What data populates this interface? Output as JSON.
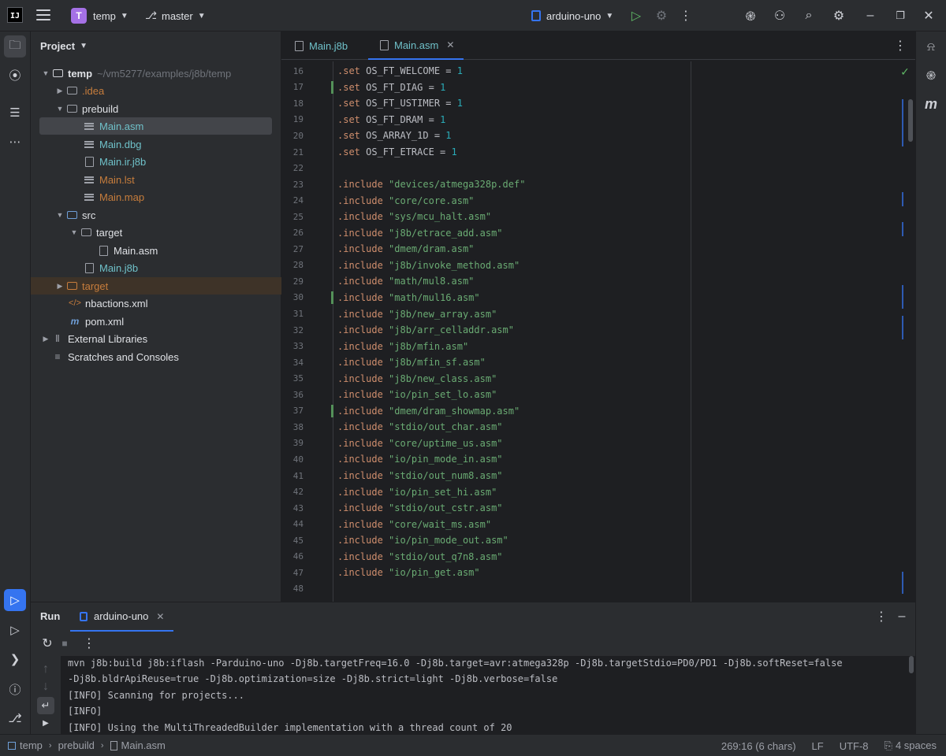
{
  "titlebar": {
    "project_badge": "T",
    "project_name": "temp",
    "branch": "master",
    "run_config": "arduino-uno"
  },
  "project_panel": {
    "title": "Project",
    "tree": [
      {
        "label": "temp",
        "path": "~/vm5277/examples/j8b/temp"
      },
      {
        "label": ".idea"
      },
      {
        "label": "prebuild"
      },
      {
        "label": "Main.asm"
      },
      {
        "label": "Main.dbg"
      },
      {
        "label": "Main.ir.j8b"
      },
      {
        "label": "Main.lst"
      },
      {
        "label": "Main.map"
      },
      {
        "label": "src"
      },
      {
        "label": "target"
      },
      {
        "label": "Main.asm"
      },
      {
        "label": "Main.j8b"
      },
      {
        "label": "target"
      },
      {
        "label": "nbactions.xml"
      },
      {
        "label": "pom.xml"
      },
      {
        "label": "External Libraries"
      },
      {
        "label": "Scratches and Consoles"
      }
    ]
  },
  "editor": {
    "tabs": [
      {
        "label": "Main.j8b"
      },
      {
        "label": "Main.asm"
      }
    ],
    "lines": [
      {
        "n": "16",
        "d": ".set",
        "t": " OS_FT_WELCOME = ",
        "v": "1"
      },
      {
        "n": "17",
        "d": ".set",
        "t": " OS_FT_DIAG = ",
        "v": "1"
      },
      {
        "n": "18",
        "d": ".set",
        "t": " OS_FT_USTIMER = ",
        "v": "1"
      },
      {
        "n": "19",
        "d": ".set",
        "t": " OS_FT_DRAM = ",
        "v": "1"
      },
      {
        "n": "20",
        "d": ".set",
        "t": " OS_ARRAY_1D = ",
        "v": "1"
      },
      {
        "n": "21",
        "d": ".set",
        "t": " OS_FT_ETRACE = ",
        "v": "1"
      },
      {
        "n": "22",
        "d": "",
        "t": "",
        "v": ""
      },
      {
        "n": "23",
        "d": ".include",
        "s": "\"devices/atmega328p.def\""
      },
      {
        "n": "24",
        "d": ".include",
        "s": "\"core/core.asm\""
      },
      {
        "n": "25",
        "d": ".include",
        "s": "\"sys/mcu_halt.asm\""
      },
      {
        "n": "26",
        "d": ".include",
        "s": "\"j8b/etrace_add.asm\""
      },
      {
        "n": "27",
        "d": ".include",
        "s": "\"dmem/dram.asm\""
      },
      {
        "n": "28",
        "d": ".include",
        "s": "\"j8b/invoke_method.asm\""
      },
      {
        "n": "29",
        "d": ".include",
        "s": "\"math/mul8.asm\""
      },
      {
        "n": "30",
        "d": ".include",
        "s": "\"math/mul16.asm\""
      },
      {
        "n": "31",
        "d": ".include",
        "s": "\"j8b/new_array.asm\""
      },
      {
        "n": "32",
        "d": ".include",
        "s": "\"j8b/arr_celladdr.asm\""
      },
      {
        "n": "33",
        "d": ".include",
        "s": "\"j8b/mfin.asm\""
      },
      {
        "n": "34",
        "d": ".include",
        "s": "\"j8b/mfin_sf.asm\""
      },
      {
        "n": "35",
        "d": ".include",
        "s": "\"j8b/new_class.asm\""
      },
      {
        "n": "36",
        "d": ".include",
        "s": "\"io/pin_set_lo.asm\""
      },
      {
        "n": "37",
        "d": ".include",
        "s": "\"dmem/dram_showmap.asm\""
      },
      {
        "n": "38",
        "d": ".include",
        "s": "\"stdio/out_char.asm\""
      },
      {
        "n": "39",
        "d": ".include",
        "s": "\"core/uptime_us.asm\""
      },
      {
        "n": "40",
        "d": ".include",
        "s": "\"io/pin_mode_in.asm\""
      },
      {
        "n": "41",
        "d": ".include",
        "s": "\"stdio/out_num8.asm\""
      },
      {
        "n": "42",
        "d": ".include",
        "s": "\"io/pin_set_hi.asm\""
      },
      {
        "n": "43",
        "d": ".include",
        "s": "\"stdio/out_cstr.asm\""
      },
      {
        "n": "44",
        "d": ".include",
        "s": "\"core/wait_ms.asm\""
      },
      {
        "n": "45",
        "d": ".include",
        "s": "\"io/pin_mode_out.asm\""
      },
      {
        "n": "46",
        "d": ".include",
        "s": "\"stdio/out_q7n8.asm\""
      },
      {
        "n": "47",
        "d": ".include",
        "s": "\"io/pin_get.asm\""
      },
      {
        "n": "48",
        "d": "",
        "s": ""
      }
    ]
  },
  "run_panel": {
    "title": "Run",
    "tab": "arduino-uno",
    "console": [
      "mvn j8b:build j8b:iflash -Parduino-uno -Dj8b.targetFreq=16.0 -Dj8b.target=avr:atmega328p -Dj8b.targetStdio=PD0/PD1 -Dj8b.softReset=false",
      "-Dj8b.bldrApiReuse=true -Dj8b.optimization=size -Dj8b.strict=light -Dj8b.verbose=false",
      "[INFO] Scanning for projects...",
      "[INFO]",
      "[INFO] Using the MultiThreadedBuilder implementation with a thread count of 20"
    ]
  },
  "statusbar": {
    "crumbs": [
      "temp",
      "prebuild",
      "Main.asm"
    ],
    "position": "269:16 (6 chars)",
    "line_sep": "LF",
    "encoding": "UTF-8",
    "indent": "4 spaces"
  }
}
